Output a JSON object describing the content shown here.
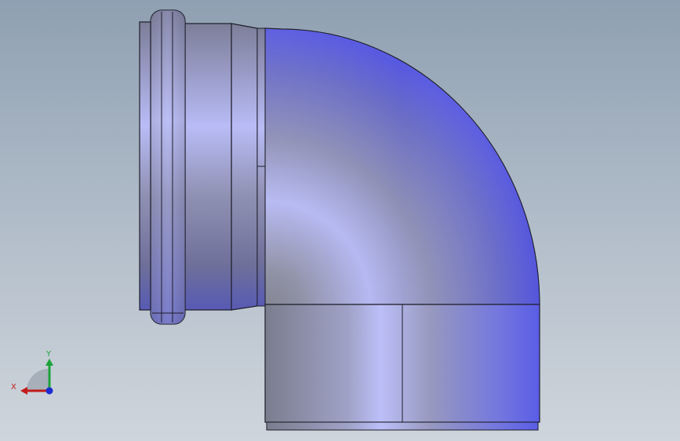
{
  "viewport": {
    "background_top": "#8fa0b2",
    "background_bottom": "#cfd5dc"
  },
  "model": {
    "part": "pipe-elbow-90",
    "shade_light": "#b7bcf8",
    "shade_mid": "#8e90b4",
    "shade_dark": "#5c5fd6",
    "edge_color": "#1e1e2a"
  },
  "triad": {
    "x_label": "X",
    "y_label": "Y",
    "x_color": "#c21b1b",
    "y_color": "#1aa33a",
    "z_color": "#1b2bd0"
  }
}
